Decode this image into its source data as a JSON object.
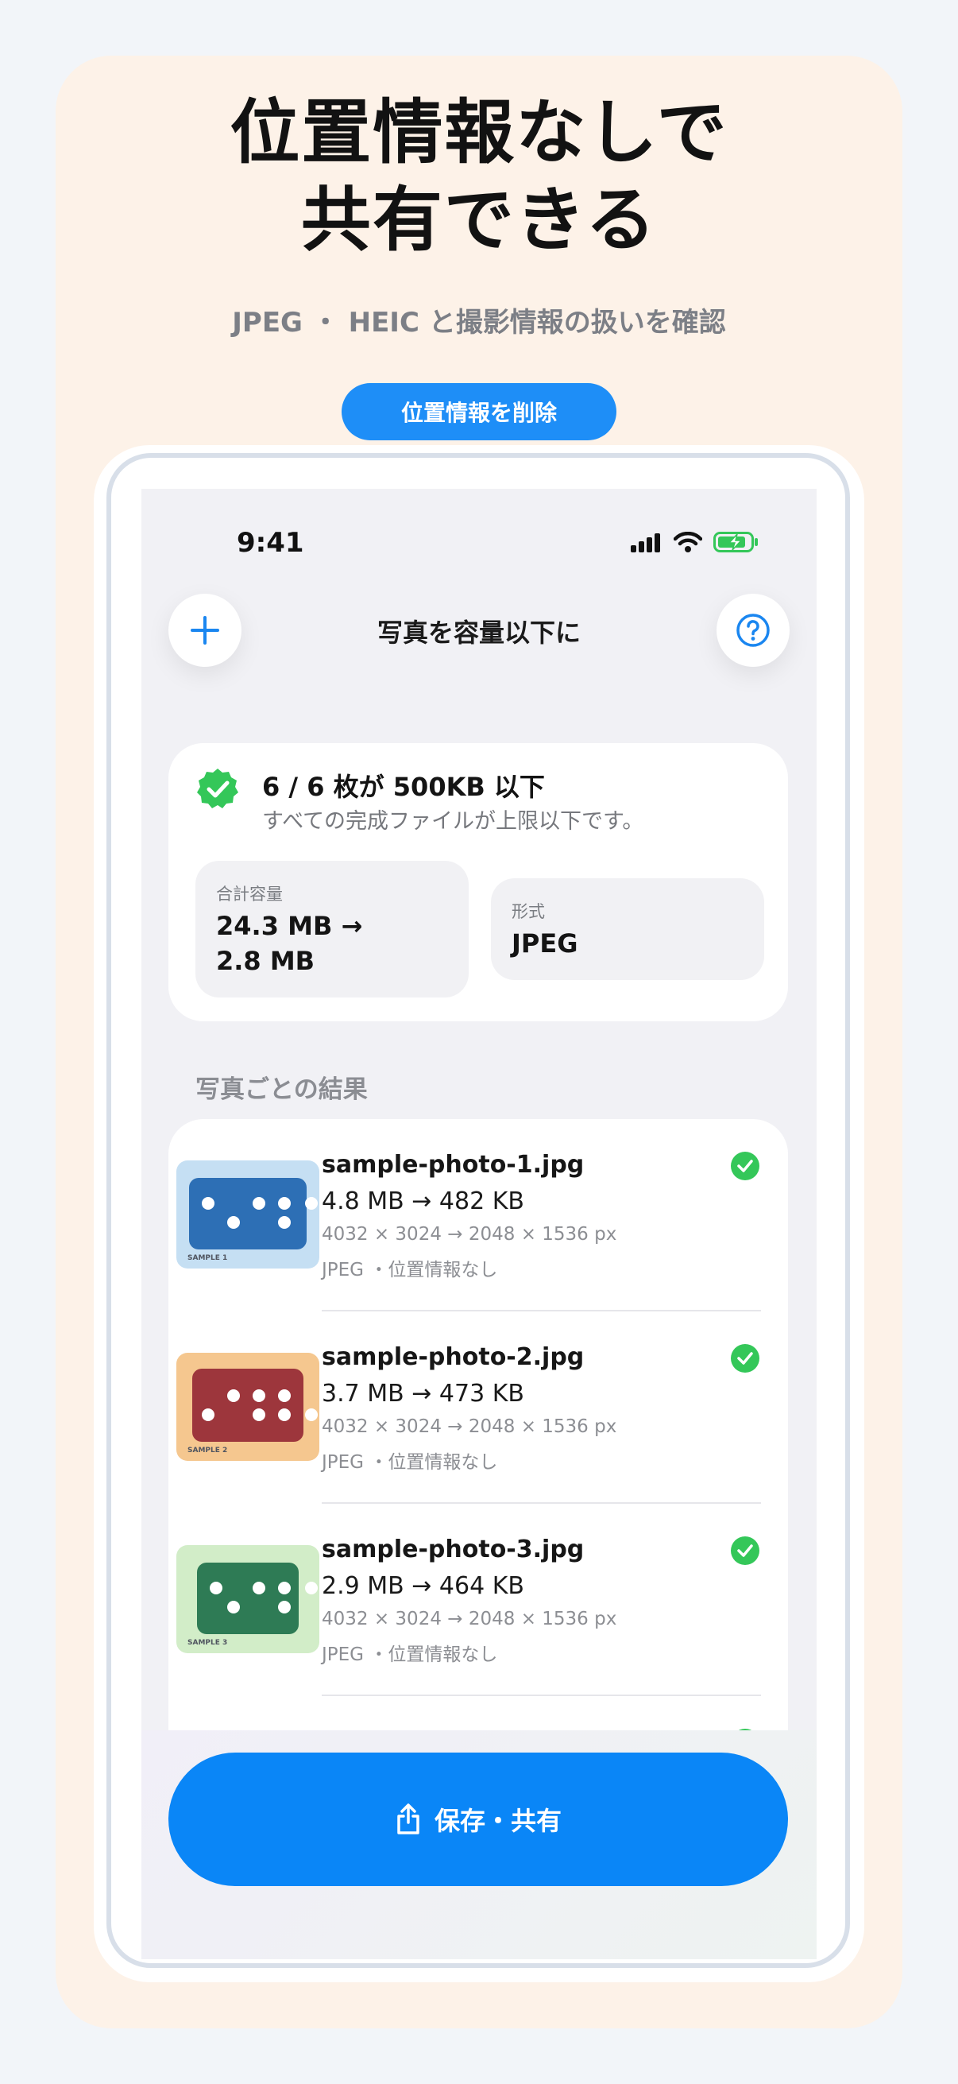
{
  "promo": {
    "headline_line1": "位置情報なしで",
    "headline_line2": "共有できる",
    "subtitle": "JPEG ・ HEIC と撮影情報の扱いを確認",
    "pill_label": "位置情報を削除"
  },
  "status_bar": {
    "time": "9:41"
  },
  "nav": {
    "title": "写真を容量以下に",
    "add_icon": "plus-icon",
    "help_icon": "question-circle-icon"
  },
  "summary": {
    "title": "6 / 6 枚が 500KB 以下",
    "subtitle": "すべての完成ファイルが上限以下です。",
    "total_label": "合計容量",
    "total_line1": "24.3 MB →",
    "total_line2": "2.8 MB",
    "format_label": "形式",
    "format_value": "JPEG"
  },
  "section_title": "写真ごとの結果",
  "photos": [
    {
      "name": "sample-photo-1.jpg",
      "size": "4.8 MB → 482 KB",
      "dims": "4032 × 3024 → 2048 × 1536 px",
      "meta": "JPEG ・位置情報なし",
      "thumb_caption": "SAMPLE 1",
      "thumb_bg": "#c5dff3",
      "thumb_fg": "#2d6fb5"
    },
    {
      "name": "sample-photo-2.jpg",
      "size": "3.7 MB → 473 KB",
      "dims": "4032 × 3024 → 2048 × 1536 px",
      "meta": "JPEG ・位置情報なし",
      "thumb_caption": "SAMPLE 2",
      "thumb_bg": "#f5c78f",
      "thumb_fg": "#9d363c"
    },
    {
      "name": "sample-photo-3.jpg",
      "size": "2.9 MB → 464 KB",
      "dims": "4032 × 3024 → 2048 × 1536 px",
      "meta": "JPEG ・位置情報なし",
      "thumb_caption": "SAMPLE 3",
      "thumb_bg": "#d2edc8",
      "thumb_fg": "#2e7b55"
    }
  ],
  "share_button": {
    "label": "保存・共有",
    "icon": "share-icon"
  },
  "colors": {
    "accent": "#0a86f7",
    "success": "#34c759",
    "card_bg": "#fdf2e8"
  }
}
